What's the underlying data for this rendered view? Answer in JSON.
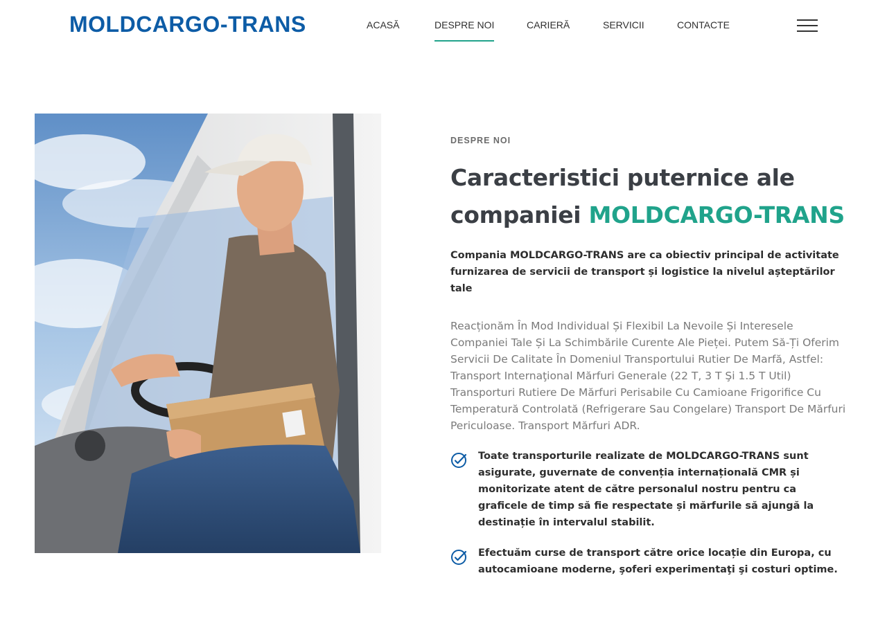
{
  "header": {
    "logo": "MOLDCARGO-TRANS",
    "nav": [
      {
        "label": "ACASĂ",
        "active": false
      },
      {
        "label": "DESPRE NOI",
        "active": true
      },
      {
        "label": "CARIERĂ",
        "active": false
      },
      {
        "label": "SERVICII",
        "active": false
      },
      {
        "label": "CONTACTE",
        "active": false
      }
    ],
    "menu_icon": "hamburger-menu-icon"
  },
  "about": {
    "eyebrow": "DESPRE NOI",
    "title_part1": "Caracteristici puternice ale companiei ",
    "title_accent": "MOLDCARGO-TRANS",
    "lead": "Compania MOLDCARGO-TRANS are ca obiectiv principal de activitate furnizarea de servicii de transport și logistice la nivelul așteptărilor tale",
    "body": "Reacționăm În Mod Individual Și Flexibil La Nevoile Și Interesele Companiei Tale Și La Schimbările Curente Ale Pieței. Putem Să-Ți Oferim Servicii De Calitate În Domeniul Transportului Rutier De Marfă, Astfel: Transport Internaţional Mărfuri Generale (22 T, 3 T Şi 1.5 T Util) Transporturi Rutiere De Mărfuri Perisabile Cu Camioane Frigorifice Cu Temperatură Controlată (Refrigerare Sau Congelare) Transport De Mărfuri Periculoase. Transport Mărfuri ADR.",
    "features": [
      {
        "icon": "check-circle-icon",
        "text": "Toate transporturile realizate de MOLDCARGO-TRANS sunt asigurate, guvernate de convenția internațională CMR și monitorizate atent de către personalul nostru pentru ca graficele de timp să fie respectate și mărfurile să ajungă la destinație în intervalul stabilit."
      },
      {
        "icon": "check-circle-icon",
        "text": "Efectuăm curse de transport către orice locație din Europa, cu autocamioane moderne, şoferi experimentaţi şi costuri optime."
      }
    ]
  },
  "colors": {
    "brand_blue": "#0d5ca6",
    "accent_green": "#20a38b",
    "heading": "#3b3f45",
    "body_gray": "#7a7a7a"
  },
  "image": {
    "icon": "delivery-driver-photo"
  }
}
